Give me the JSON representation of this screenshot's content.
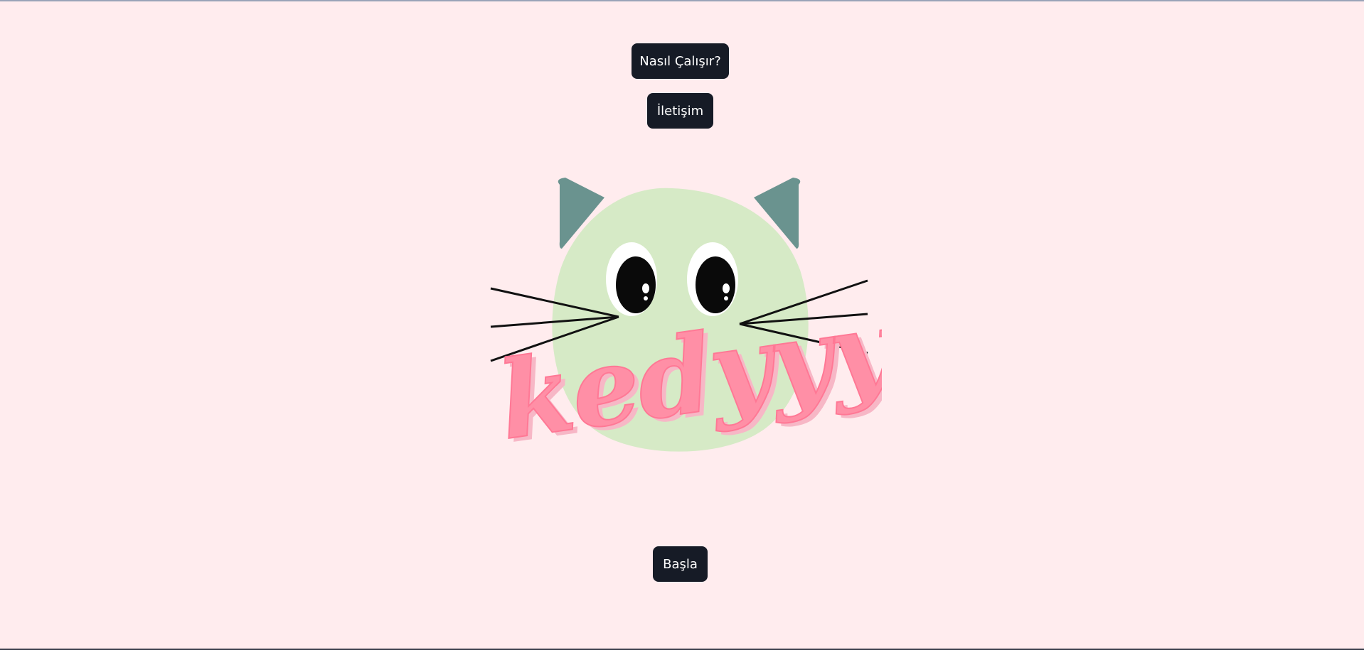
{
  "nav": {
    "how_it_works_label": "Nasıl Çalışır?",
    "contact_label": "İletişim"
  },
  "logo": {
    "wordmark": "kedyyy",
    "colors": {
      "face": "#d6eac6",
      "ears": "#6a938f",
      "wordmark": "#ff8fa6",
      "wordmark_shadow": "#f7b7c6"
    }
  },
  "actions": {
    "start_label": "Başla"
  },
  "colors": {
    "background": "#ffecee",
    "button": "#161b26",
    "button_text": "#ffffff"
  }
}
